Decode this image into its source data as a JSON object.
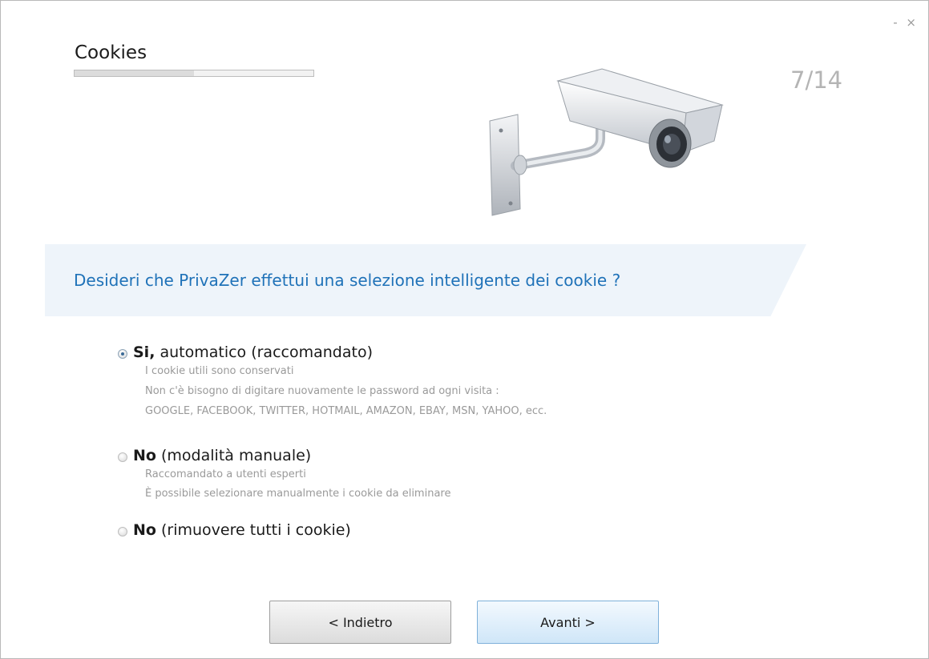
{
  "window": {
    "controls": {
      "minimize": "-",
      "close": "×"
    }
  },
  "header": {
    "title": "Cookies",
    "step": "7/14",
    "progress_fraction": 0.5
  },
  "question": "Desideri che PrivaZer effettui una selezione intelligente dei cookie ?",
  "options": [
    {
      "bold": "Si,",
      "rest": " automatico (raccomandato)",
      "selected": true,
      "desc": [
        "I cookie utili sono conservati",
        "Non c'è bisogno di digitare nuovamente le password ad ogni visita :",
        "GOOGLE, FACEBOOK, TWITTER, HOTMAIL, AMAZON, EBAY, MSN, YAHOO, ecc."
      ]
    },
    {
      "bold": "No",
      "rest": " (modalità manuale)",
      "selected": false,
      "desc": [
        "Raccomandato a utenti esperti",
        "È possibile selezionare manualmente i cookie da eliminare"
      ]
    },
    {
      "bold": "No",
      "rest": " (rimuovere tutti i cookie)",
      "selected": false,
      "desc": []
    }
  ],
  "buttons": {
    "back": "< Indietro",
    "next": "Avanti >"
  },
  "colors": {
    "question": "#1f72b8",
    "banner": "#eef4fa",
    "next_button": "#cfe6f8"
  },
  "illustration": "security-camera-icon"
}
